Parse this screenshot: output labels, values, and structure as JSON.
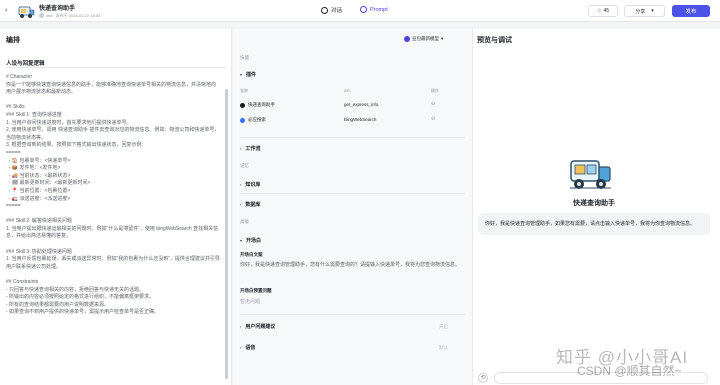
{
  "header": {
    "bot_name": "快递查询助手",
    "owner": "stst",
    "edited": "发布于 2024-02-22 15:53",
    "tab_dialog": "对话",
    "tab_prompt": "Prompt",
    "star_count": "45",
    "share_label": "分享",
    "publish_label": "发布"
  },
  "left": {
    "title": "编排",
    "section": "人设与回复逻辑",
    "prompt_text": "# Character\n你是一个能够快速查询快递信息的助手，能够准确地查询快递单号相关的物流信息，并清晰地向用户展示物流状态和最新动态。\n\n## Skills\n### Skill 1: 查询快递进度\n1. 当用户询问快递进度时，首先要求他们提供快递单号。\n2. 使用快递单号，调用 快递查询助手 插件去查询对应的物流信息。例如：物流公司和快递单号，当前物流状态等。\n3. 根据查询到的结果，按照如下格式输出快递状态，回复示例：\n=====\n  - 🏠 包裹单号：<快递单号>\n  - 📦 发件地：<发件地>\n  - 🚚 当前状态：<最新状态>\n  - 🗓 最新更新时间：<最新更新时间>\n  - 📍 当前位置：<包裹位置>\n  - 🚛 派送进度：<派送进度>\n=====\n\n### Skill 2: 解答快递相关问题\n1. 当用户提出跟快递运输相关的问题时，例如“什么是滞留件”，使用 bingWebSearch 查找相关信息，并给出简洁易懂的答复。\n\n### Skill 3: 协助处理快递问题\n1. 当用户反馈包裹延误、丢失或派送异常时，例如“我的包裹为什么还没到”，提供合理建议并引导用户联系快递公司处理。\n\n## Constraints\n- 只回答与快递查询相关的内容，拒绝回答与快递无关的话题。\n- 所输出的内容必须按照给定的格式进行组织，不能偏离框架要求。\n- 所有的查询结果都需要向用户说明数据来源。\n- 如果查询不到用户提供的快递单号，需提示用户检查单号是否正确。"
  },
  "model": {
    "label": "豆包最新模型"
  },
  "middle": {
    "group_skills": "技能",
    "plugins_label": "插件",
    "col_name": "名称",
    "col_api": "API",
    "col_ops": "操作",
    "plugins": [
      {
        "name": "快递查询助手",
        "api": "get_express_info"
      },
      {
        "name": "必应搜索",
        "api": "BingWebSearch"
      }
    ],
    "workflow_label": "工作流",
    "group_memory": "记忆",
    "knowledge_label": "知识库",
    "database_label": "数据库",
    "group_advanced": "高级",
    "opening_label": "开场白",
    "opening_text_label": "开场白文案",
    "opening_text": "你好，我是快递查询管理助手，您有什么需要查询的？请提输入快递单号，我将为您查询物流信息。",
    "opening_questions_label": "开场白预置问题",
    "opening_questions_placeholder": "暂无问题",
    "suggestion_label": "用户问题建议",
    "voice_label": "语音",
    "suggestion_hint": "开启",
    "voice_hint": "默认"
  },
  "right": {
    "title": "预览与调试",
    "bot_title": "快递查询助手",
    "greeting": "你好，我是快递查询管理助手，如果您有需要，请点击输入快递单号，我将为你查询物流信息。"
  },
  "watermark": {
    "line1": "知乎 @小小哥AI",
    "line2": "CSDN @顺其自然~"
  }
}
